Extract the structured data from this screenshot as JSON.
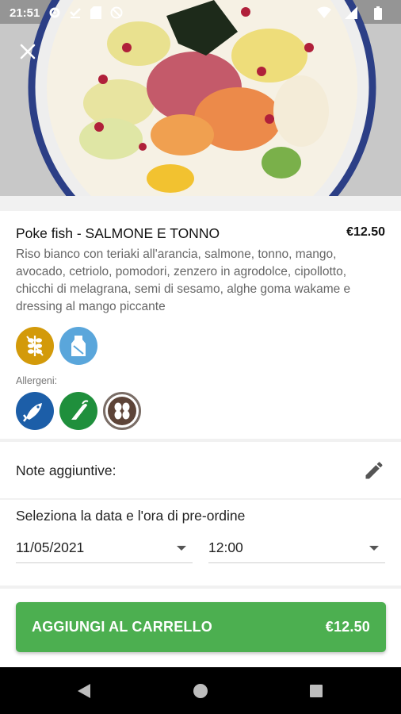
{
  "status_bar": {
    "time": "21:51"
  },
  "product": {
    "name": "Poke fish - SALMONE E TONNO",
    "price": "€12.50",
    "description": "Riso bianco con teriaki all'arancia, salmone, tonno, mango, avocado, cetriolo, pomodori, zenzero in agrodolce, cipollotto, chicchi di melagrana, semi di sesamo, alghe goma wakame e dressing al mango piccante",
    "feature_icons": [
      {
        "icon": "gluten-free-icon",
        "color": "#d39a0a"
      },
      {
        "icon": "lactose-free-icon",
        "color": "#5aa6db"
      }
    ],
    "allergens_label": "Allergeni:",
    "allergen_icons": [
      {
        "icon": "fish-allergen-icon",
        "color": "#1c5ea8"
      },
      {
        "icon": "celery-allergen-icon",
        "color": "#1f8f3c"
      },
      {
        "icon": "sesame-allergen-icon",
        "color": "#5d4438"
      }
    ]
  },
  "notes": {
    "label": "Note aggiuntive:"
  },
  "preorder": {
    "label": "Seleziona la data e l'ora di pre-ordine",
    "date_value": "11/05/2021",
    "time_value": "12:00"
  },
  "cta": {
    "label": "AGGIUNGI AL CARRELLO",
    "price": "€12.50",
    "color": "#4caf50"
  }
}
